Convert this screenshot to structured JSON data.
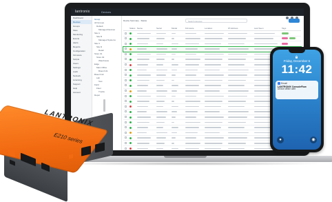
{
  "laptop": {
    "app": {
      "logo_text": "lantronix",
      "top_nav": "Devices",
      "sidebar_items": [
        "Dashboard",
        "Devices",
        "Groups",
        "Sites",
        "Monitoring",
        "Events",
        "Alerts",
        "Reports",
        "Configuration",
        "Firmware",
        "Scripts",
        "Users",
        "Settings",
        "Audit",
        "Network",
        "Licensing",
        "Support",
        "Help",
        "Account"
      ],
      "tree_header": "Group",
      "tree_items": [
        "All Groups",
        "Default",
        "Managed Devices",
        "Site A",
        "Site B",
        "Managed Systems",
        "Site C",
        "Site D",
        "Retail",
        "Store 01",
        "Store 02",
        "Warehouse",
        "Edge",
        "Main Office",
        "Branch 01",
        "Branch 02",
        "Lab",
        "Test",
        "Field",
        "Fleet",
        "Trucks",
        "Depot"
      ],
      "toolbar_tabs": "Device Summary  ·  Status",
      "search_placeholder": "Search devices",
      "column_headers": [
        "",
        "Status",
        "Name",
        "Serial",
        "Model",
        "Firmware",
        "Location",
        "IP Address",
        "Last Seen",
        "Tags"
      ]
    }
  },
  "phone": {
    "date": "Friday, December 6",
    "time": "11:42",
    "notification": {
      "app": "Email",
      "title": "LANTRONIX ConsoleFlow",
      "body": "Device offline alert"
    }
  },
  "device": {
    "brand": "LANTRONIX",
    "series": "E210 series"
  },
  "colors": {
    "device_orange": "#f26b12",
    "row_highlight": "#2eb34a",
    "accent_blue": "#2f86d6",
    "phone_gradient_top": "#3ea2e4"
  }
}
